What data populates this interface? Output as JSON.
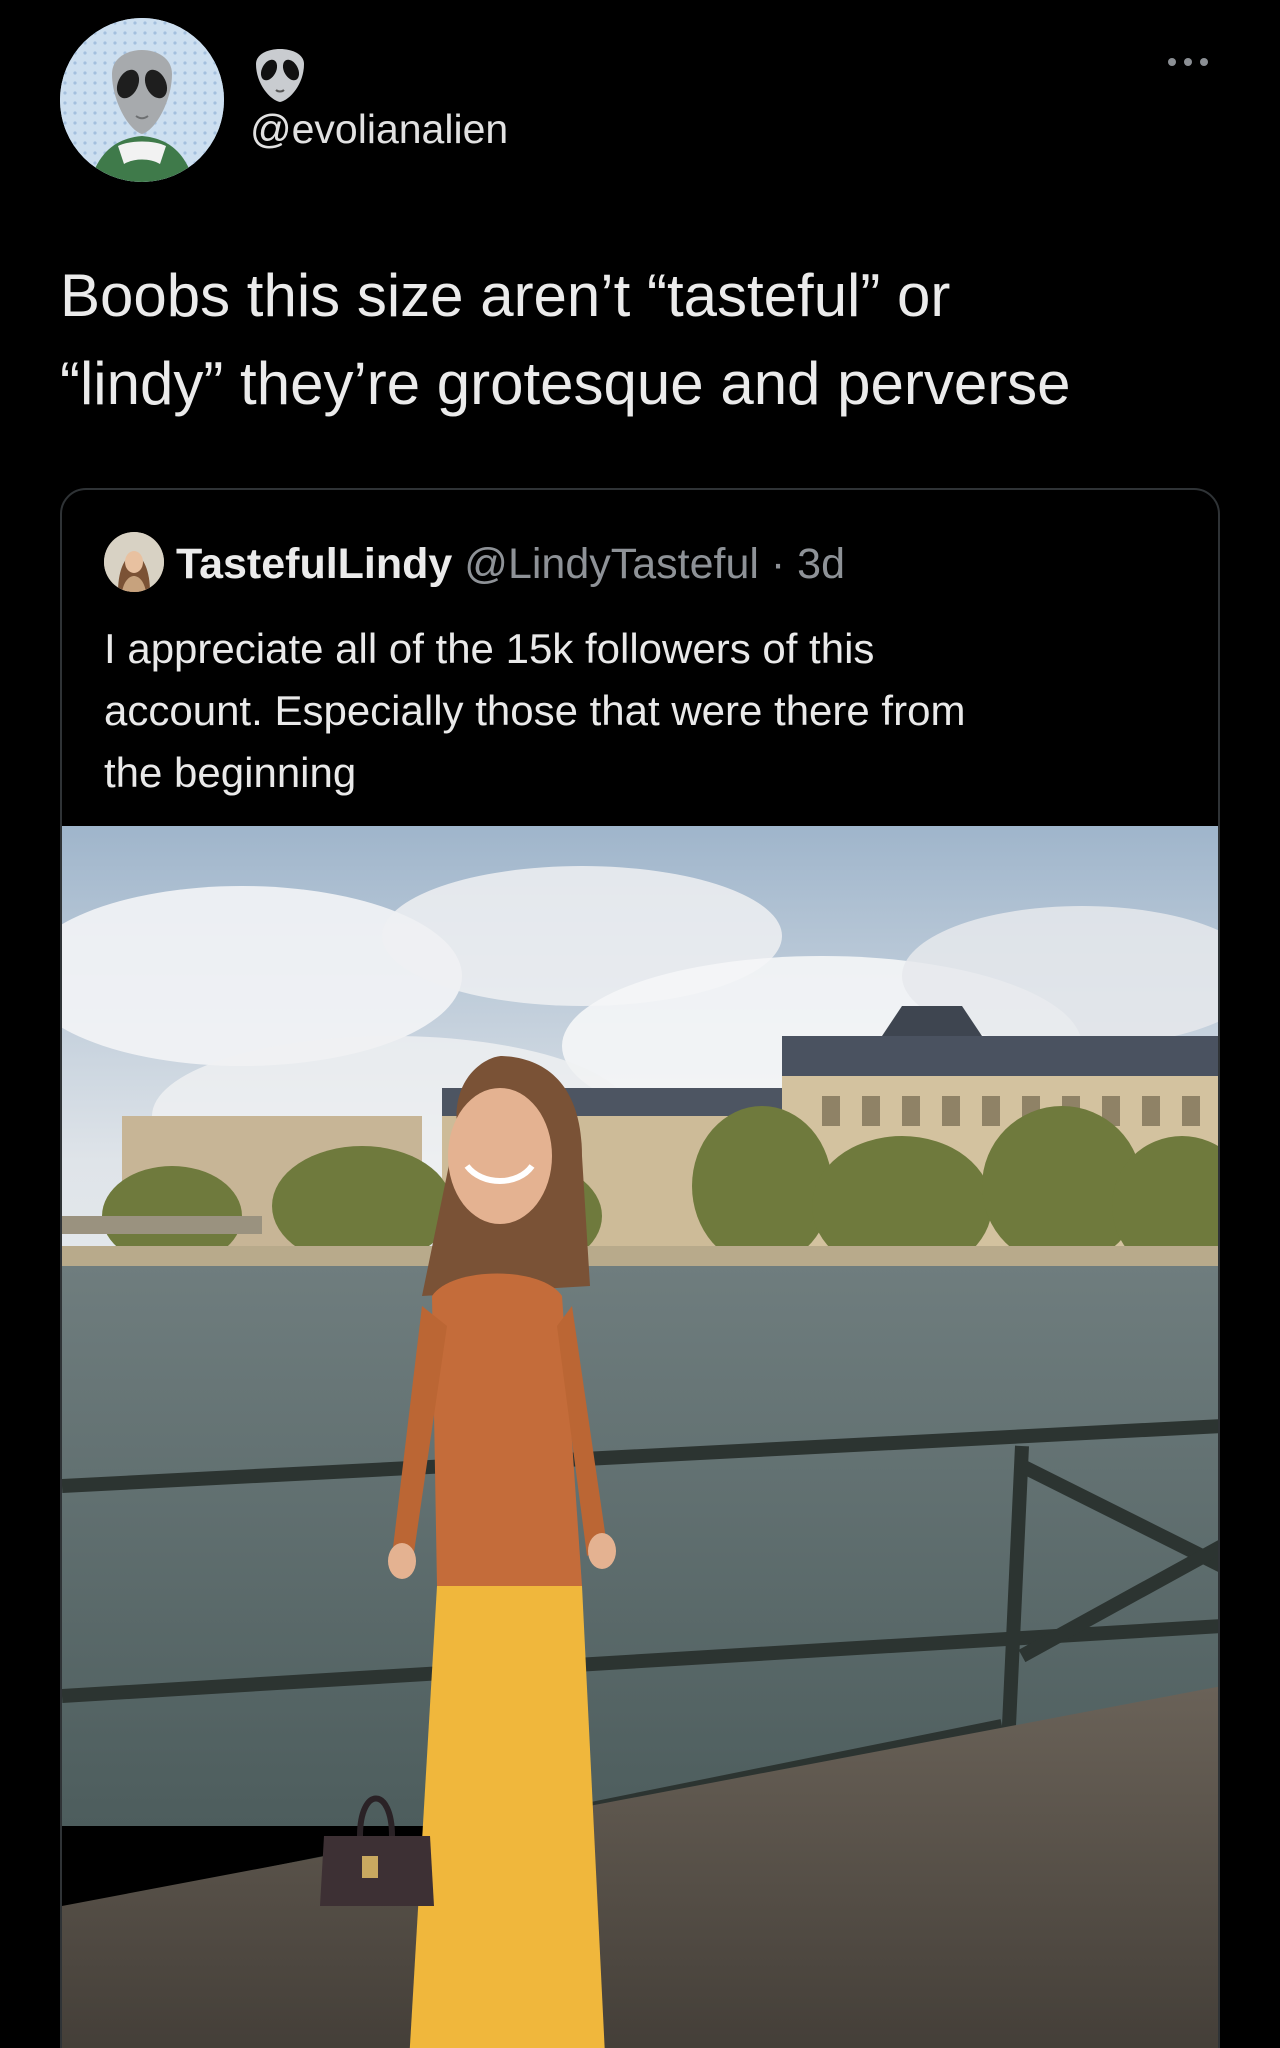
{
  "tweet": {
    "handle": "@evolianalien",
    "avatar_icon": "alien-avatar",
    "handle_emoji_icon": "alien-emoji-icon",
    "more_icon": "more-options-icon",
    "text": "Boobs this size aren’t “tasteful” or\n“lindy” they’re grotesque and perverse"
  },
  "quoted_tweet": {
    "display_name": "TastefulLindy",
    "handle": "@LindyTasteful",
    "separator": " · ",
    "time": "3d",
    "text": "I appreciate all of the 15k followers of this\naccount. Especially those that were there from\nthe beginning",
    "media_icon": "attached-photo"
  },
  "colors": {
    "background": "#000000",
    "text_primary": "#e7e9ea",
    "text_secondary": "#8e9297",
    "border": "#2f3336"
  }
}
